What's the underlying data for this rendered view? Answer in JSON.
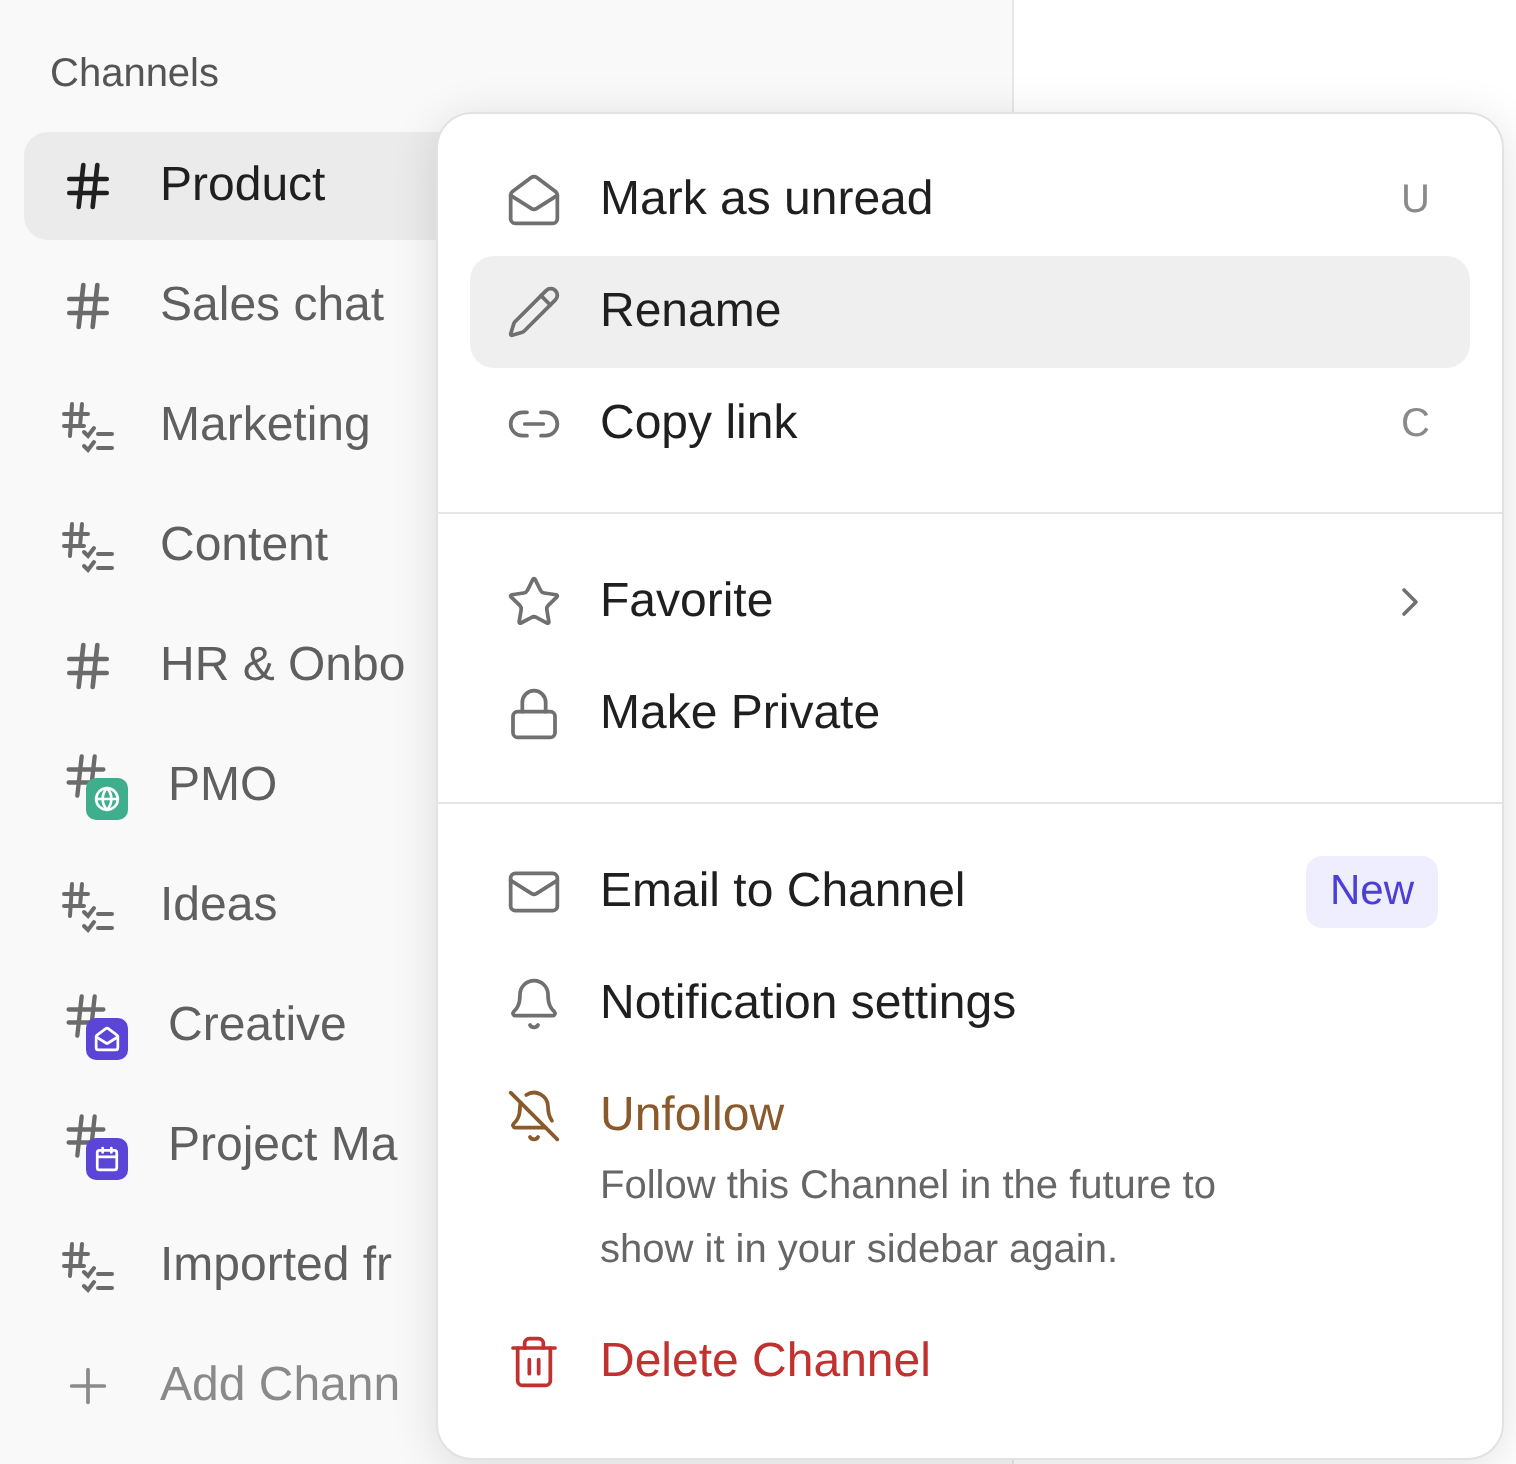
{
  "sidebar": {
    "heading": "Channels",
    "channels": [
      {
        "name": "Product",
        "kind": "hash",
        "selected": true
      },
      {
        "name": "Sales chat",
        "kind": "hash",
        "selected": false
      },
      {
        "name": "Marketing",
        "kind": "list",
        "selected": false
      },
      {
        "name": "Content",
        "kind": "list",
        "selected": false
      },
      {
        "name": "HR & Onbo",
        "kind": "hash",
        "selected": false
      },
      {
        "name": "PMO",
        "kind": "globe",
        "color": "#3fae8c",
        "selected": false
      },
      {
        "name": "Ideas",
        "kind": "list",
        "selected": false
      },
      {
        "name": "Creative",
        "kind": "form",
        "color": "#5b45d6",
        "selected": false
      },
      {
        "name": "Project Ma",
        "kind": "calendar",
        "color": "#5b45d6",
        "selected": false
      },
      {
        "name": "Imported fr",
        "kind": "list",
        "selected": false
      }
    ],
    "add_label": "Add Chann"
  },
  "menu": {
    "sections": [
      [
        {
          "label": "Mark as unread",
          "shortcut": "U",
          "selected": false
        },
        {
          "label": "Rename",
          "selected": true
        },
        {
          "label": "Copy link",
          "shortcut": "C",
          "selected": false
        }
      ],
      [
        {
          "label": "Favorite",
          "submenu": true,
          "selected": false
        },
        {
          "label": "Make Private",
          "selected": false
        }
      ],
      [
        {
          "label": "Email to Channel",
          "badge": "New",
          "selected": false
        },
        {
          "label": "Notification settings",
          "selected": false
        },
        {
          "label": "Unfollow",
          "kind": "warning",
          "description": "Follow this Channel in the future to show it in your sidebar again.",
          "selected": false
        },
        {
          "label": "Delete Channel",
          "kind": "danger",
          "selected": false
        }
      ]
    ]
  }
}
